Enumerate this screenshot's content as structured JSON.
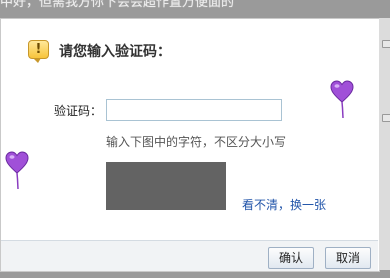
{
  "background": {
    "partial_text": "中好，但需我方你下会会超作置万便面的"
  },
  "dialog": {
    "title": "请您输入验证码：",
    "warning_icon_glyph": "!",
    "field_label": "验证码：",
    "input_value": "",
    "input_placeholder": "",
    "hint": "输入下图中的字符，不区分大小写",
    "refresh_link": "看不清，换一张",
    "ok_button": "确认",
    "cancel_button": "取消"
  },
  "colors": {
    "balloon": "#a050d8",
    "link": "#2255aa",
    "captcha_fill": "#636363"
  }
}
